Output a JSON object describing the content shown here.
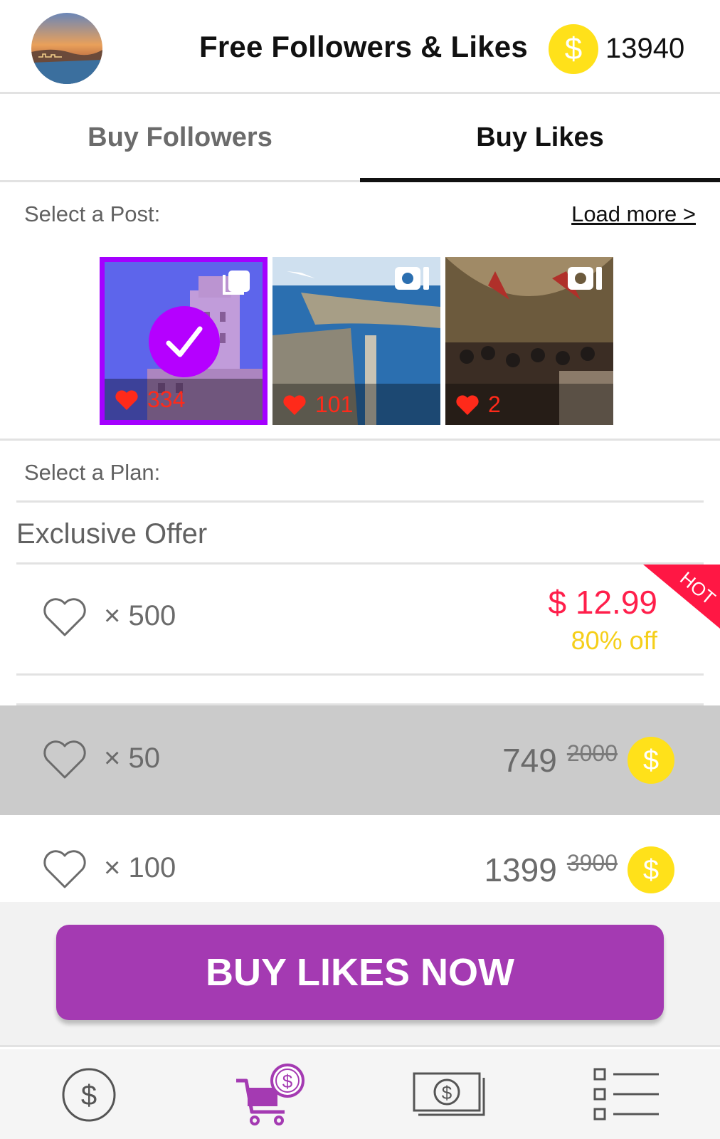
{
  "header": {
    "title": "Free Followers & Likes",
    "coins": "13940",
    "coin_symbol": "$"
  },
  "tabs": [
    {
      "label": "Buy Followers",
      "active": false
    },
    {
      "label": "Buy Likes",
      "active": true
    }
  ],
  "post_section": {
    "label": "Select a Post:",
    "load_more": "Load more >",
    "posts": [
      {
        "likes": "334",
        "type": "multi-photo",
        "selected": true
      },
      {
        "likes": "101",
        "type": "video",
        "selected": false
      },
      {
        "likes": "2",
        "type": "video",
        "selected": false
      }
    ]
  },
  "plan_section": {
    "label": "Select a Plan:",
    "exclusive_title": "Exclusive Offer",
    "exclusive_plan": {
      "quantity": "× 500",
      "price": "$ 12.99",
      "discount": "80% off",
      "badge": "HOT"
    },
    "coin_plans": [
      {
        "quantity": "× 50",
        "price": "749",
        "old_price": "2000",
        "coin_symbol": "$",
        "selected": true
      },
      {
        "quantity": "× 100",
        "price": "1399",
        "old_price": "3900",
        "coin_symbol": "$",
        "selected": false
      }
    ]
  },
  "cta": {
    "label": "BUY LIKES NOW"
  },
  "bottom_nav": {
    "icons": [
      "coin-icon",
      "cart-icon",
      "cash-icon",
      "list-icon"
    ],
    "active": "cart-icon"
  },
  "colors": {
    "accent": "#a43ab2",
    "selection": "#a400ff",
    "coin": "#ffe11a",
    "price_red": "#ff1f4b",
    "discount_yellow": "#f5cf1a",
    "hot": "#ff1744"
  }
}
